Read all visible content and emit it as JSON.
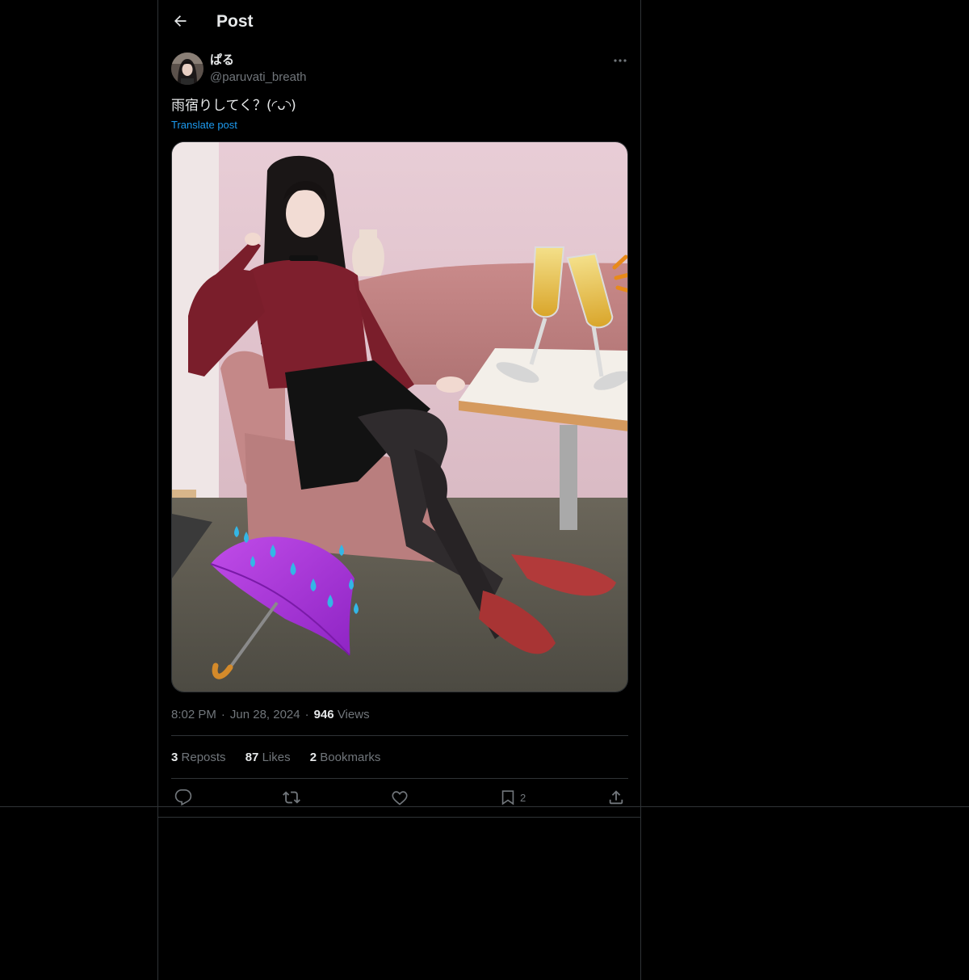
{
  "header": {
    "title": "Post",
    "back_icon": "arrow-left-icon"
  },
  "author": {
    "display_name": "ぱる",
    "handle": "@paruvati_breath",
    "more_icon": "ellipsis-icon"
  },
  "tweet": {
    "text": "雨宿りしてく？(◜ᴗ◝)",
    "translate_label": "Translate post",
    "time": "8:02 PM",
    "date": "Jun 28, 2024",
    "views_count": "946",
    "views_label": "Views",
    "separator": "·"
  },
  "stats": {
    "reposts_count": "3",
    "reposts_label": "Reposts",
    "likes_count": "87",
    "likes_label": "Likes",
    "bookmarks_count": "2",
    "bookmarks_label": "Bookmarks"
  },
  "actions": {
    "reply_icon": "reply-icon",
    "repost_icon": "repost-icon",
    "like_icon": "heart-icon",
    "bookmark_icon": "bookmark-icon",
    "bookmark_count": "2",
    "share_icon": "share-icon"
  },
  "colors": {
    "background": "#000000",
    "text_primary": "#e7e9ea",
    "text_secondary": "#71767b",
    "accent": "#1d9bf0",
    "border": "#2f3336"
  }
}
